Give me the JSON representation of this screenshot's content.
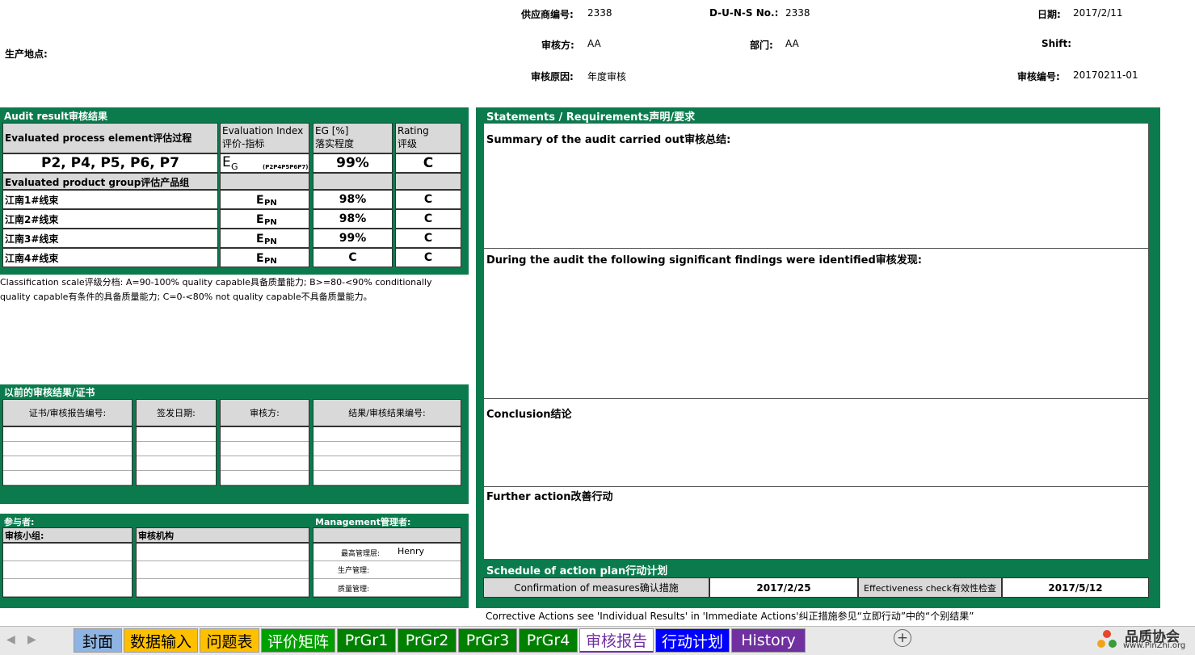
{
  "header": {
    "supplier_no_label": "供应商编号:",
    "supplier_no": "2338",
    "duns_label": "D-U-N-S No.:",
    "duns": "2338",
    "date_label": "日期:",
    "date": "2017/2/11",
    "site_label": "生产地点:",
    "auditor_label": "审核方:",
    "auditor": "AA",
    "dept_label": "部门:",
    "dept": "AA",
    "shift_label": "Shift:",
    "reason_label": "审核原因:",
    "reason": "年度审核",
    "audit_no_label": "审核编号:",
    "audit_no": "20170211-01"
  },
  "audit_result": {
    "title": "Audit result审核结果",
    "col_process": "Evaluated process element评估过程",
    "col_index": "Evaluation Index",
    "col_index_cn": "评价-指标",
    "col_eg": "EG [%]",
    "col_eg_cn": "落实程度",
    "col_rating": "Rating",
    "col_rating_cn": "评级",
    "process_elements": "P2, P4, P5, P6, P7",
    "eg_main": "E",
    "eg_sub": "G",
    "eg_small": "(P2P4P5P6P7)",
    "eg_value": "99%",
    "eg_rating": "C",
    "product_group_label": "Evaluated product group评估产品组",
    "rows": [
      {
        "name": "江南1#线束",
        "idx": "E",
        "sub": "PN",
        "eg": "98%",
        "rating": "C"
      },
      {
        "name": "江南2#线束",
        "idx": "E",
        "sub": "PN",
        "eg": "98%",
        "rating": "C"
      },
      {
        "name": "江南3#线束",
        "idx": "E",
        "sub": "PN",
        "eg": "99%",
        "rating": "C"
      },
      {
        "name": "江南4#线束",
        "idx": "E",
        "sub": "PN",
        "eg": "C",
        "rating": "C"
      }
    ],
    "classification_line1": "Classification scale评级分档: A=90-100% quality capable具备质量能力; B>=80-<90% conditionally",
    "classification_line2": "quality capable有条件的具备质量能力; C=0-<80% not quality capable不具备质量能力。"
  },
  "previous": {
    "title": "以前的审核结果/证书",
    "col1": "证书/审核报告编号:",
    "col2": "签发日期:",
    "col3": "审核方:",
    "col4": "结果/审核结果编号:"
  },
  "participants": {
    "title": "参与者:",
    "mgmt_title": "Management管理者:",
    "team_label": "审核小组:",
    "org_label": "审核机构",
    "top_mgmt_label": "最高管理层:",
    "top_mgmt_value": "Henry",
    "prod_mgmt_label": "生产管理:",
    "quality_mgmt_label": "质量管理:"
  },
  "statements": {
    "title": "Statements / Requirements声明/要求",
    "summary_label": "Summary of the audit carried out审核总结:",
    "findings_label": "During the audit the following significant findings were identified审核发现:",
    "conclusion_label": "Conclusion结论",
    "further_label": "Further action改善行动",
    "schedule_title": "Schedule of action plan行动计划",
    "confirm_label": "Confirmation of measures确认措施",
    "confirm_date": "2017/2/25",
    "effect_label": "Effectiveness check有效性检查",
    "effect_date": "2017/5/12",
    "footnote": "Corrective Actions see 'Individual Results' in 'Immediate Actions'纠正措施参见“立即行动”中的“个别结果”"
  },
  "tabs": [
    {
      "label": "封面",
      "bg": "#8db4e2",
      "fg": "#000"
    },
    {
      "label": "数据输入",
      "bg": "#ffc000",
      "fg": "#000"
    },
    {
      "label": "问题表",
      "bg": "#ffc000",
      "fg": "#000"
    },
    {
      "label": "评价矩阵",
      "bg": "#00a000",
      "fg": "#fff"
    },
    {
      "label": "PrGr1",
      "bg": "#008000",
      "fg": "#fff"
    },
    {
      "label": "PrGr2",
      "bg": "#008000",
      "fg": "#fff"
    },
    {
      "label": "PrGr3",
      "bg": "#008000",
      "fg": "#fff"
    },
    {
      "label": "PrGr4",
      "bg": "#008000",
      "fg": "#fff"
    },
    {
      "label": "审核报告",
      "bg": "#ffffff",
      "fg": "#7030a0"
    },
    {
      "label": "行动计划",
      "bg": "#0000ff",
      "fg": "#fff"
    },
    {
      "label": "History",
      "bg": "#7030a0",
      "fg": "#fff"
    }
  ],
  "watermark": {
    "cn": "品质协会",
    "url": "www.PinZhi.org"
  }
}
